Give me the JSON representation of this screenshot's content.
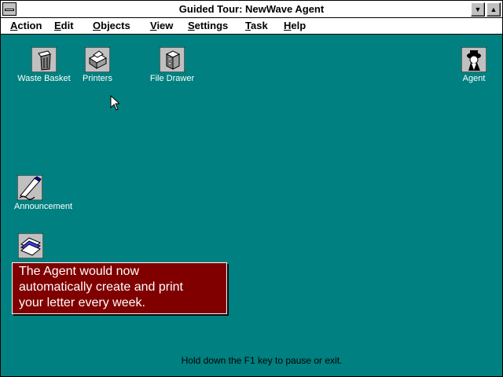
{
  "window": {
    "title": "Guided Tour: NewWave Agent",
    "minimize_glyph": "▼",
    "maximize_glyph": "▲"
  },
  "menu": [
    {
      "underline": "A",
      "rest": "ction"
    },
    {
      "underline": "E",
      "rest": "dit"
    },
    {
      "underline": "O",
      "rest": "bjects"
    },
    {
      "underline": "V",
      "rest": "iew"
    },
    {
      "underline": "S",
      "rest": "ettings"
    },
    {
      "underline": "T",
      "rest": "ask"
    },
    {
      "underline": "H",
      "rest": "elp"
    }
  ],
  "desktop": {
    "icons": [
      {
        "label": "Waste Basket",
        "icon": "waste-basket-icon"
      },
      {
        "label": "Printers",
        "icon": "printer-icon"
      },
      {
        "label": "File Drawer",
        "icon": "file-drawer-icon"
      },
      {
        "label": "Agent",
        "icon": "agent-icon"
      },
      {
        "label": "Announcement",
        "icon": "announcement-icon"
      },
      {
        "label": "",
        "icon": "document-stack-icon"
      }
    ]
  },
  "message": {
    "lines": [
      "The Agent would now",
      "automatically create and print",
      "your letter every week."
    ]
  },
  "hint": "Hold down the F1 key to pause or exit.",
  "colors": {
    "desktop": "#008080",
    "message_bg": "#800000",
    "titlebar": "#ffffff"
  }
}
